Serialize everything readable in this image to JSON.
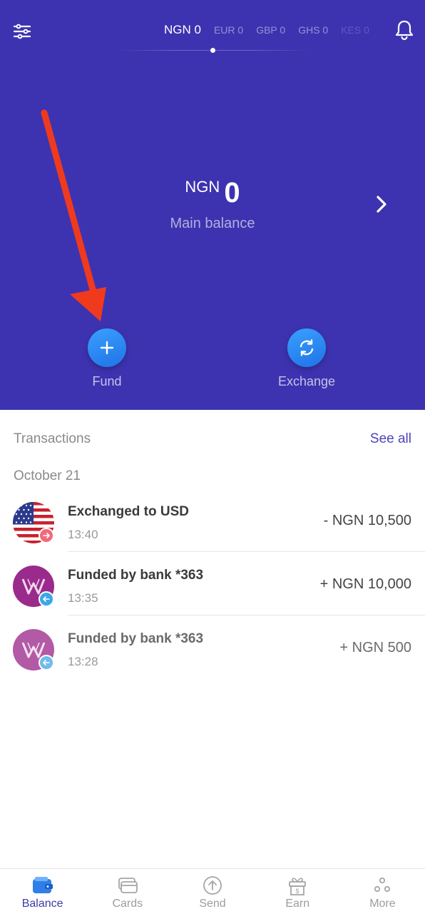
{
  "header": {
    "currency_tabs": [
      {
        "label": "NGN 0",
        "active": true
      },
      {
        "label": "EUR 0",
        "active": false
      },
      {
        "label": "GBP 0",
        "active": false
      },
      {
        "label": "GHS 0",
        "active": false
      },
      {
        "label": "KES 0",
        "active": false
      }
    ],
    "settings_icon": "sliders-icon",
    "notification_icon": "bell-icon"
  },
  "balance": {
    "currency": "NGN",
    "amount": "0",
    "label": "Main balance"
  },
  "actions": {
    "fund_label": "Fund",
    "exchange_label": "Exchange"
  },
  "transactions": {
    "title": "Transactions",
    "see_all": "See all",
    "date_group": "October 21",
    "items": [
      {
        "name": "Exchanged to USD",
        "time": "13:40",
        "amount": "- NGN 10,500",
        "avatar": "us-flag-icon",
        "badge": "arrow-right-icon"
      },
      {
        "name": "Funded by bank *363",
        "time": "13:35",
        "amount": "+ NGN 10,000",
        "avatar": "bank-logo-icon",
        "badge": "arrow-left-icon"
      },
      {
        "name": "Funded by bank *363",
        "time": "13:28",
        "amount": "+ NGN 500",
        "avatar": "bank-logo-icon",
        "badge": "arrow-left-icon"
      }
    ]
  },
  "nav": {
    "items": [
      {
        "label": "Balance",
        "icon": "wallet-icon",
        "active": true
      },
      {
        "label": "Cards",
        "icon": "cards-icon",
        "active": false
      },
      {
        "label": "Send",
        "icon": "send-icon",
        "active": false
      },
      {
        "label": "Earn",
        "icon": "gift-icon",
        "active": false
      },
      {
        "label": "More",
        "icon": "more-icon",
        "active": false
      }
    ]
  },
  "colors": {
    "hero_bg": "#3d33b0",
    "accent_blue": "#1f73e6",
    "nav_active": "#3d3aa8",
    "annotation_red": "#f03a1e"
  }
}
